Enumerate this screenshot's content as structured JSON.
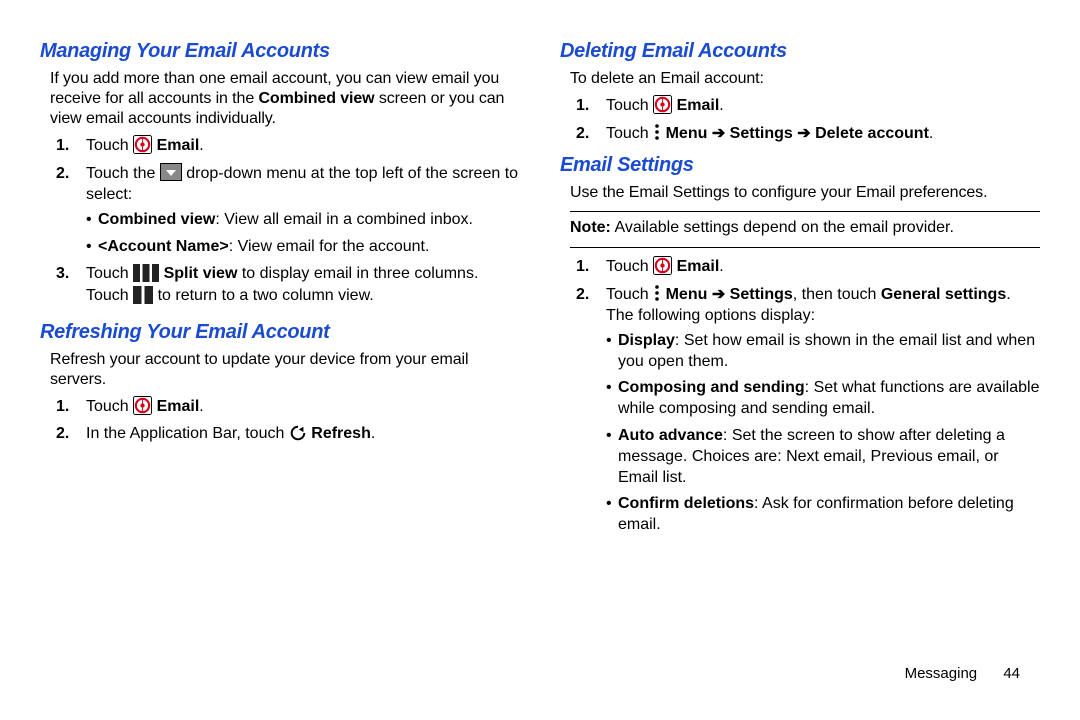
{
  "left": {
    "h_managing": "Managing Your Email Accounts",
    "managing_intro_a": "If you add more than one email account, you can view email you receive for all accounts in the ",
    "managing_intro_b": "Combined view",
    "managing_intro_c": " screen or you can view email accounts individually.",
    "managing_steps": {
      "s1_a": "Touch ",
      "s1_b": "Email",
      "s1_c": ".",
      "s2_a": "Touch the ",
      "s2_b": " drop-down menu at the top left of the screen to select:",
      "s2_bullets": {
        "b1_a": "Combined view",
        "b1_b": ": View all email in a combined inbox.",
        "b2_a": "<Account Name>",
        "b2_b": ": View email for the account."
      },
      "s3_a": "Touch ",
      "s3_b": "Split view",
      "s3_c": " to display email in three columns. Touch ",
      "s3_d": " to return to a two column view."
    },
    "h_refreshing": "Refreshing Your Email Account",
    "refresh_intro": "Refresh your account to update your device from your email servers.",
    "refresh_steps": {
      "r1_a": "Touch ",
      "r1_b": "Email",
      "r1_c": ".",
      "r2_a": "In the Application Bar, touch ",
      "r2_b": "Refresh",
      "r2_c": "."
    }
  },
  "right": {
    "h_deleting": "Deleting Email Accounts",
    "del_intro": "To delete an Email account:",
    "del_steps": {
      "d1_a": "Touch ",
      "d1_b": "Email",
      "d1_c": ".",
      "d2_a": "Touch ",
      "d2_b": "Menu ",
      "d2_arrow1": "➔",
      "d2_c": " Settings ",
      "d2_arrow2": "➔",
      "d2_d": " Delete account",
      "d2_e": "."
    },
    "h_settings": "Email Settings",
    "settings_intro": "Use the Email Settings to configure your Email preferences.",
    "note_a": "Note:",
    "note_b": " Available settings depend on the email provider.",
    "settings_steps": {
      "e1_a": "Touch ",
      "e1_b": "Email",
      "e1_c": ".",
      "e2_a": "Touch ",
      "e2_b": "Menu ",
      "e2_arrow": "➔",
      "e2_c": " Settings",
      "e2_d": ", then touch ",
      "e2_e": "General settings",
      "e2_f": ". The following options display:",
      "e2_bullets": {
        "b1_a": "Display",
        "b1_b": ": Set how email is shown in the email list and when you open them.",
        "b2_a": "Composing and sending",
        "b2_b": ": Set what functions are available while composing and sending email.",
        "b3_a": "Auto advance",
        "b3_b": ": Set the screen to show after deleting a message. Choices are: Next email, Previous email, or Email list.",
        "b4_a": "Confirm deletions",
        "b4_b": ": Ask for confirmation before deleting email."
      }
    }
  },
  "footer": {
    "section": "Messaging",
    "page": "44"
  }
}
